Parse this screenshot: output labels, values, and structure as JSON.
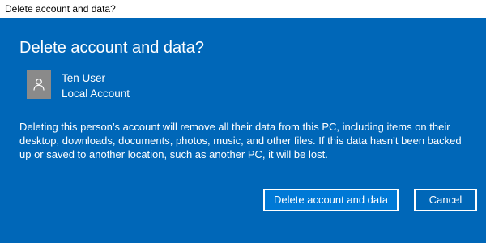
{
  "window": {
    "title": "Delete account and data?"
  },
  "dialog": {
    "heading": "Delete account and data?",
    "user": {
      "name": "Ten User",
      "account_type": "Local Account",
      "avatar_icon": "person-icon"
    },
    "message": "Deleting this person’s account will remove all their data from this PC, including items on their desktop, downloads, documents, photos, music, and other files. If this data hasn’t been backed up or saved to another location, such as another PC, it will be lost.",
    "buttons": {
      "delete_label": "Delete account and data",
      "cancel_label": "Cancel"
    }
  },
  "colors": {
    "dialog_background": "#0067b8",
    "primary_button": "#0079d6",
    "avatar_background": "#8a8a8a",
    "text": "#ffffff"
  }
}
